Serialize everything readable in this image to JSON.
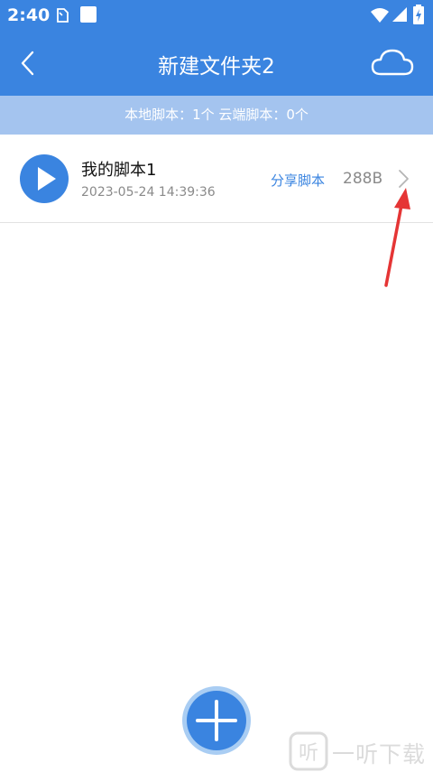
{
  "status_bar": {
    "time": "2:40",
    "icons": [
      "clipboard-icon",
      "square-notification-icon",
      "wifi-icon",
      "signal-icon",
      "battery-charging-icon"
    ]
  },
  "app_bar": {
    "title": "新建文件夹2",
    "back_icon": "back-chevron-icon",
    "cloud_icon": "cloud-icon",
    "background_color": "#3a84e0"
  },
  "summary": {
    "text": "本地脚本：1个 云端脚本：0个",
    "background_color": "#a4c4ef"
  },
  "scripts": [
    {
      "name": "我的脚本1",
      "date": "2023-05-24 14:39:36",
      "share_label": "分享脚本",
      "size": "288B",
      "play_icon": "play-icon",
      "chevron_icon": "chevron-right-icon"
    }
  ],
  "fab": {
    "icon": "plus-icon"
  },
  "watermark": {
    "text": "一听下载"
  },
  "colors": {
    "accent": "#3a84e0",
    "annotation": "#e53535"
  }
}
